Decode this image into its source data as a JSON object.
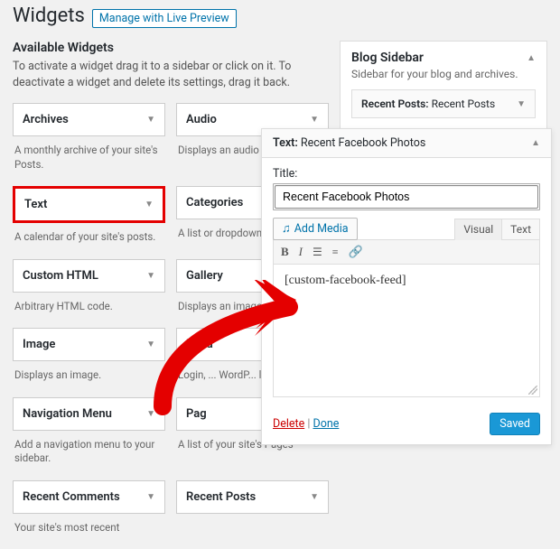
{
  "header": {
    "title": "Widgets",
    "live_preview": "Manage with Live Preview"
  },
  "available": {
    "heading": "Available Widgets",
    "desc": "To activate a widget drag it to a sidebar or click on it. To deactivate a widget and delete its settings, drag it back.",
    "items": [
      {
        "name": "Archives",
        "desc": "A monthly archive of your site's Posts."
      },
      {
        "name": "Audio",
        "desc": "Displays an audio player."
      },
      {
        "name": "Text",
        "desc": "A calendar of your site's posts."
      },
      {
        "name": "Categories",
        "desc": "A list or dropdown of cate"
      },
      {
        "name": "Custom HTML",
        "desc": "Arbitrary HTML code."
      },
      {
        "name": "Gallery",
        "desc": "Displays an image gallery"
      },
      {
        "name": "Image",
        "desc": "Displays an image."
      },
      {
        "name": "Meta",
        "desc": "Login, ... WordP... links."
      },
      {
        "name": "Navigation Menu",
        "desc": "Add a navigation menu to your sidebar."
      },
      {
        "name": "Pag",
        "desc": "A list of your site's Pages"
      },
      {
        "name": "Recent Comments",
        "desc": "Your site's most recent"
      },
      {
        "name": "Recent Posts",
        "desc": ""
      }
    ]
  },
  "sidebar": {
    "title": "Blog Sidebar",
    "desc": "Sidebar for your blog and archives.",
    "widget_prefix": "Recent Posts:",
    "widget_name": "Recent Posts"
  },
  "editor": {
    "head_prefix": "Text:",
    "head_name": "Recent Facebook Photos",
    "title_label": "Title:",
    "title_value": "Recent Facebook Photos",
    "add_media": "Add Media",
    "tab_visual": "Visual",
    "tab_text": "Text",
    "content": "[custom-facebook-feed]",
    "delete": "Delete",
    "done": "Done",
    "saved": "Saved"
  }
}
